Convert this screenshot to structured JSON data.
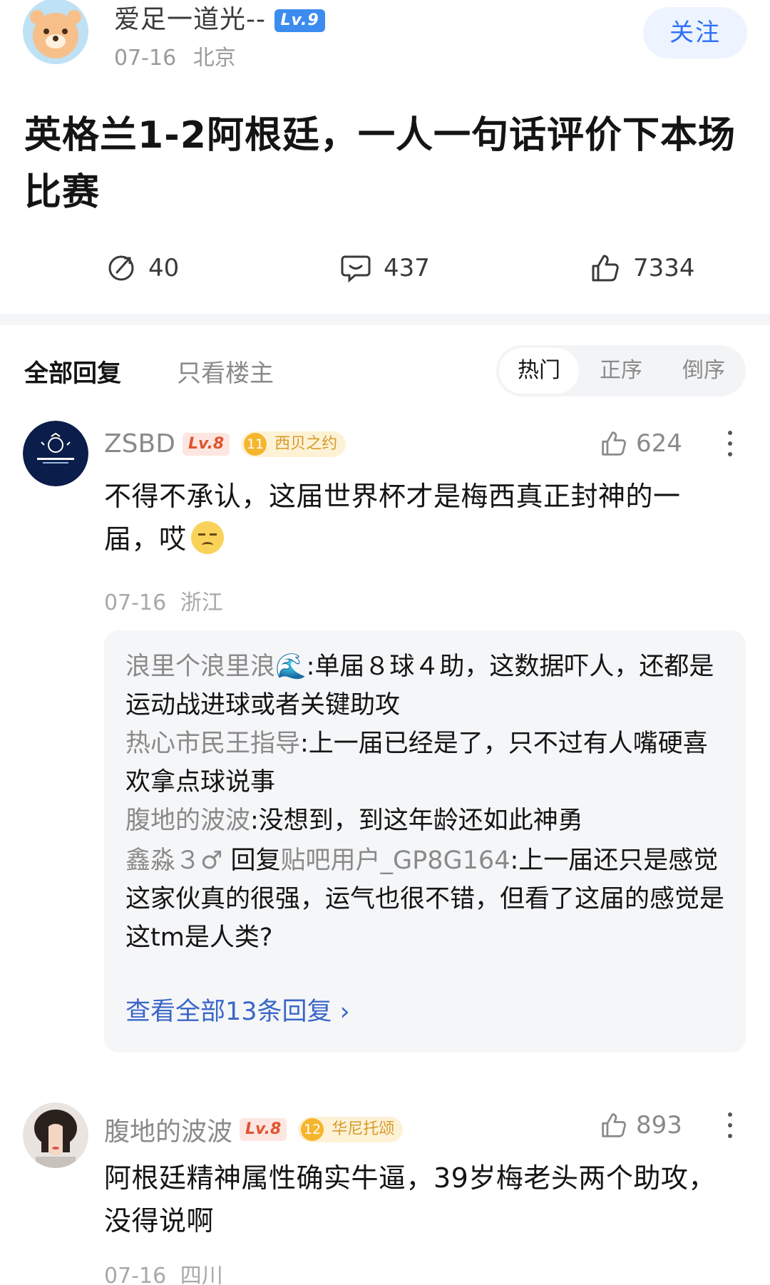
{
  "post": {
    "author": "爱足一道光--",
    "level": "Lv.9",
    "date": "07-16",
    "location": "北京",
    "follow_label": "关注",
    "title": "英格兰1-2阿根廷，一人一句话评价下本场比赛",
    "stats": {
      "shares": "40",
      "comments": "437",
      "likes": "7334"
    }
  },
  "tabs": {
    "all_replies": "全部回复",
    "op_only": "只看楼主",
    "sort_hot": "热门",
    "sort_asc": "正序",
    "sort_desc": "倒序"
  },
  "comments": [
    {
      "author": "ZSBD",
      "level": "Lv.8",
      "club_level": "11",
      "club_name": "西贝之约",
      "likes": "624",
      "text": "不得不承认，这届世界杯才是梅西真正封神的一届，哎",
      "date": "07-16",
      "location": "浙江",
      "replies": [
        {
          "name": "浪里个浪里浪🌊",
          "text": ":单届８球４助，这数据吓人，还都是运动战进球或者关键助攻"
        },
        {
          "name": "热心市民王指导",
          "text": ":上一届已经是了，只不过有人嘴硬喜欢拿点球说事"
        },
        {
          "name": "腹地的波波",
          "text": ":没想到，到这年龄还如此神勇"
        },
        {
          "name": "鑫淼３♂",
          "mid": "回复",
          "target": "贴吧用户_GP8G164",
          "text": ":上一届还只是感觉这家伙真的很强，运气也很不错，但看了这届的感觉是这tm是人类?"
        }
      ],
      "view_all": "查看全部13条回复 ›"
    },
    {
      "author": "腹地的波波",
      "level": "Lv.8",
      "club_level": "12",
      "club_name": "华尼托颂",
      "likes": "893",
      "text": "阿根廷精神属性确实牛逼，39岁梅老头两个助攻，没得说啊",
      "date": "07-16",
      "location": "四川"
    }
  ]
}
